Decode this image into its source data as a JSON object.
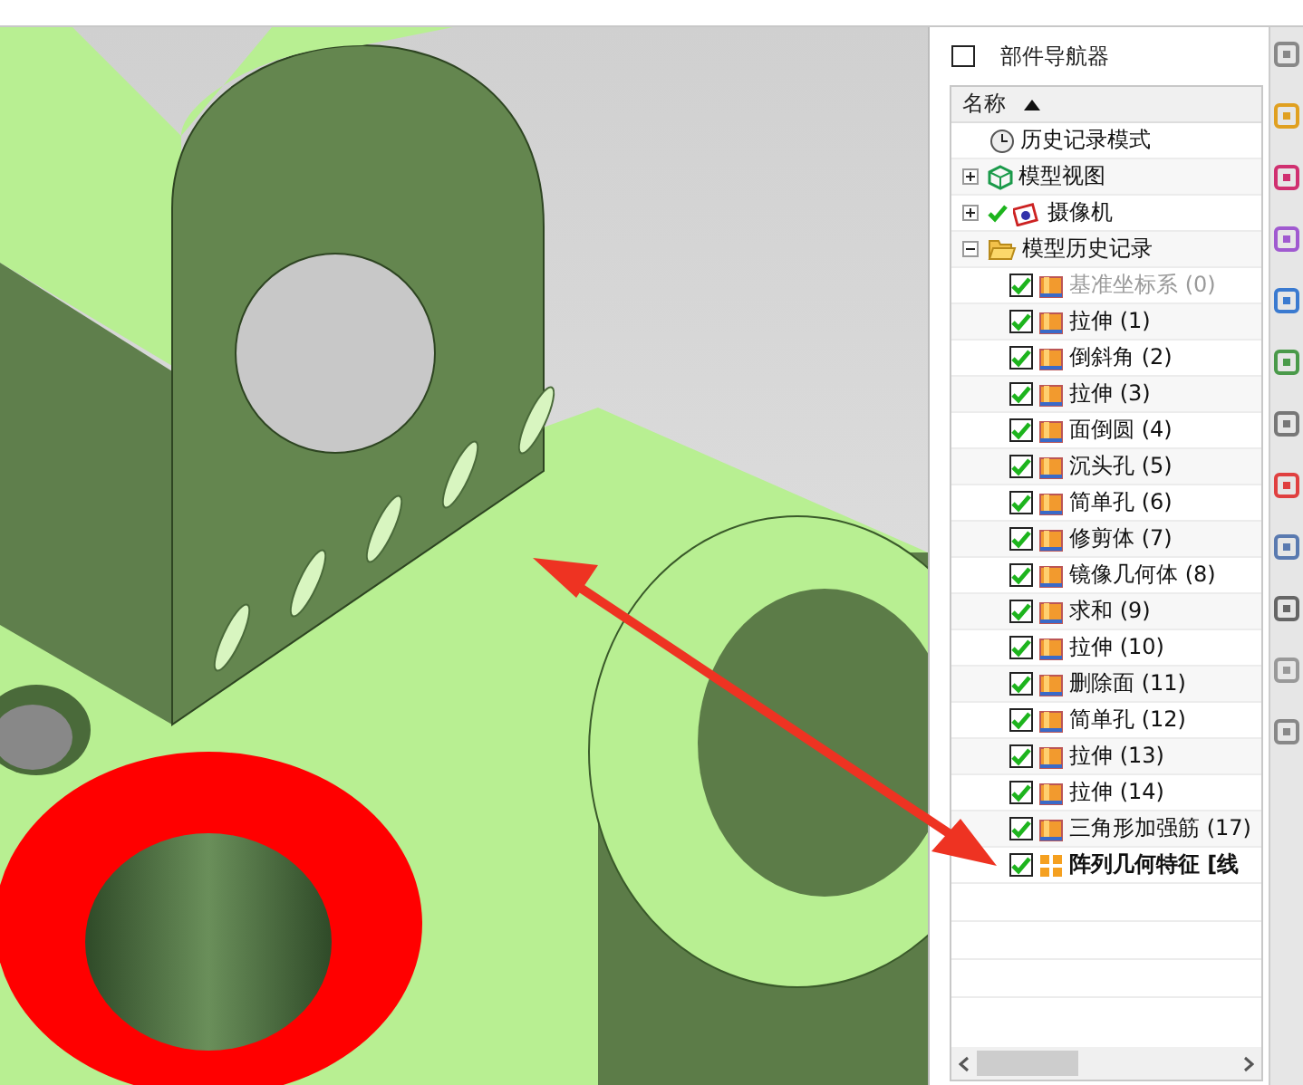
{
  "navigator": {
    "title": "部件导航器",
    "column_header": "名称",
    "nodes": [
      {
        "label": "历史记录模式",
        "kind": "clock"
      },
      {
        "label": "模型视图",
        "kind": "view",
        "expanded": false
      },
      {
        "label": "摄像机",
        "kind": "camera",
        "expanded": false,
        "checked": true
      },
      {
        "label": "模型历史记录",
        "kind": "folder",
        "expanded": true,
        "children": [
          {
            "label": "基准坐标系 (0)",
            "checked": true,
            "disabled": true,
            "current": false
          },
          {
            "label": "拉伸 (1)",
            "checked": true,
            "disabled": false,
            "current": false
          },
          {
            "label": "倒斜角 (2)",
            "checked": true,
            "disabled": false,
            "current": false
          },
          {
            "label": "拉伸 (3)",
            "checked": true,
            "disabled": false,
            "current": false
          },
          {
            "label": "面倒圆 (4)",
            "checked": true,
            "disabled": false,
            "current": false
          },
          {
            "label": "沉头孔 (5)",
            "checked": true,
            "disabled": false,
            "current": false
          },
          {
            "label": "简单孔 (6)",
            "checked": true,
            "disabled": false,
            "current": false
          },
          {
            "label": "修剪体 (7)",
            "checked": true,
            "disabled": false,
            "current": false
          },
          {
            "label": "镜像几何体 (8)",
            "checked": true,
            "disabled": false,
            "current": false
          },
          {
            "label": "求和 (9)",
            "checked": true,
            "disabled": false,
            "current": false
          },
          {
            "label": "拉伸 (10)",
            "checked": true,
            "disabled": false,
            "current": false
          },
          {
            "label": "删除面 (11)",
            "checked": true,
            "disabled": false,
            "current": false
          },
          {
            "label": "简单孔 (12)",
            "checked": true,
            "disabled": false,
            "current": false
          },
          {
            "label": "拉伸 (13)",
            "checked": true,
            "disabled": false,
            "current": false
          },
          {
            "label": "拉伸 (14)",
            "checked": true,
            "disabled": false,
            "current": false
          },
          {
            "label": "三角形加强筋 (17)",
            "checked": true,
            "disabled": false,
            "current": false
          },
          {
            "label": "阵列几何特征 [线",
            "checked": true,
            "disabled": false,
            "current": true
          }
        ]
      }
    ]
  }
}
